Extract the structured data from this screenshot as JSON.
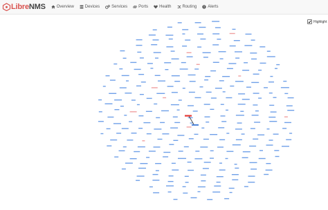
{
  "app": {
    "brand_prefix": "Libre",
    "brand_suffix": "NMS"
  },
  "nav": {
    "overview": "Overview",
    "devices": "Devices",
    "services": "Services",
    "ports": "Ports",
    "health": "Health",
    "routing": "Routing",
    "alerts": "Alerts"
  },
  "controls": {
    "highlight_label": "Highlight",
    "highlight_checked": true
  },
  "colors": {
    "node_normal": "#6fa0e8",
    "node_alert": "#f0a0a0",
    "node_highlight": "#e53935",
    "link": "#333333",
    "brand_accent": "#d9534f"
  }
}
